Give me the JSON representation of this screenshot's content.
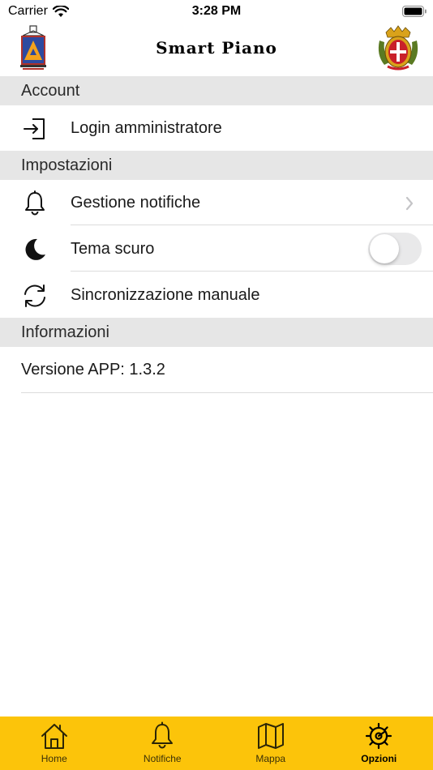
{
  "status_bar": {
    "carrier": "Carrier",
    "time": "3:28 PM"
  },
  "nav": {
    "title": "Smart Piano"
  },
  "sections": {
    "account": "Account",
    "impostazioni": "Impostazioni",
    "informazioni": "Informazioni"
  },
  "rows": {
    "login": "Login amministratore",
    "notifiche": "Gestione notifiche",
    "tema": "Tema scuro",
    "sync": "Sincronizzazione manuale"
  },
  "toggle": {
    "tema_scuro_on": false
  },
  "info": {
    "version": "Versione APP: 1.3.2"
  },
  "tabs": [
    {
      "label": "Home",
      "icon": "home-icon"
    },
    {
      "label": "Notifiche",
      "icon": "bell-icon"
    },
    {
      "label": "Mappa",
      "icon": "map-icon"
    },
    {
      "label": "Opzioni",
      "icon": "gear-icon",
      "active": true
    }
  ],
  "colors": {
    "tab_bar": "#fcc40a",
    "section_header": "#e6e6e6"
  }
}
